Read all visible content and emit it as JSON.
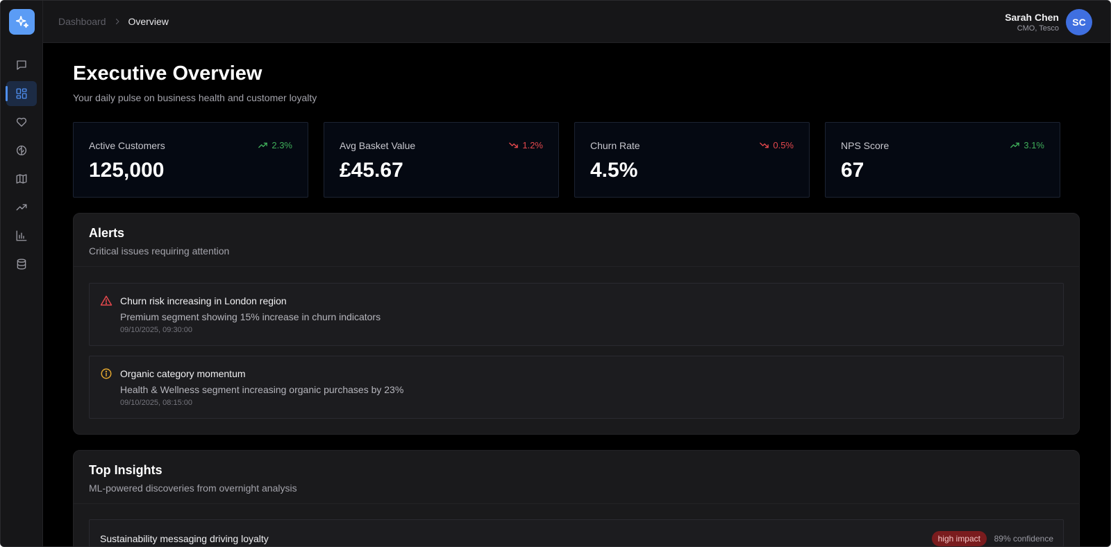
{
  "header": {
    "breadcrumb": {
      "root": "Dashboard",
      "current": "Overview"
    },
    "user": {
      "name": "Sarah Chen",
      "role": "CMO, Tesco",
      "initials": "SC"
    }
  },
  "sidebar": {
    "items": [
      {
        "icon": "chat-icon"
      },
      {
        "icon": "dashboard-grid-icon",
        "active": true
      },
      {
        "icon": "heart-icon"
      },
      {
        "icon": "brain-icon"
      },
      {
        "icon": "map-icon"
      },
      {
        "icon": "trending-up-icon"
      },
      {
        "icon": "bar-chart-icon"
      },
      {
        "icon": "database-icon"
      }
    ]
  },
  "page": {
    "title": "Executive Overview",
    "subtitle": "Your daily pulse on business health and customer loyalty"
  },
  "kpis": [
    {
      "label": "Active Customers",
      "value": "125,000",
      "trend": "2.3%",
      "direction": "up"
    },
    {
      "label": "Avg Basket Value",
      "value": "£45.67",
      "trend": "1.2%",
      "direction": "down"
    },
    {
      "label": "Churn Rate",
      "value": "4.5%",
      "trend": "0.5%",
      "direction": "down"
    },
    {
      "label": "NPS Score",
      "value": "67",
      "trend": "3.1%",
      "direction": "up"
    }
  ],
  "alerts": {
    "title": "Alerts",
    "subtitle": "Critical issues requiring attention",
    "items": [
      {
        "severity": "critical",
        "icon": "warning-triangle-icon",
        "title": "Churn risk increasing in London region",
        "description": "Premium segment showing 15% increase in churn indicators",
        "timestamp": "09/10/2025, 09:30:00"
      },
      {
        "severity": "info",
        "icon": "info-circle-icon",
        "title": "Organic category momentum",
        "description": "Health & Wellness segment increasing organic purchases by 23%",
        "timestamp": "09/10/2025, 08:15:00"
      }
    ]
  },
  "insights": {
    "title": "Top Insights",
    "subtitle": "ML-powered discoveries from overnight analysis",
    "items": [
      {
        "title": "Sustainability messaging driving loyalty",
        "impact": "high impact",
        "confidence": "89% confidence"
      }
    ]
  },
  "colors": {
    "accent": "#4f8ff0",
    "trend_up": "#3fae5a",
    "trend_down": "#e5484d",
    "warning": "#e5484d",
    "info": "#e3a72f"
  }
}
